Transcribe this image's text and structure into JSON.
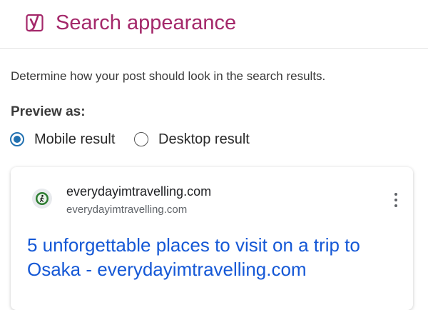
{
  "header": {
    "title": "Search appearance",
    "logo_icon": "yoast-logo-icon",
    "brand_color": "#a4286a"
  },
  "description": "Determine how your post should look in the search results.",
  "preview": {
    "label": "Preview as:",
    "options": [
      {
        "label": "Mobile result",
        "checked": true
      },
      {
        "label": "Desktop result",
        "checked": false
      }
    ],
    "accent_color": "#2271b1"
  },
  "snippet": {
    "favicon_icon": "hiker-favicon-icon",
    "site_name": "everydayimtravelling.com",
    "site_url": "everydayimtravelling.com",
    "menu_icon": "more-vertical-icon",
    "title": "5 unforgettable places to visit on a trip to Osaka - everydayimtravelling.com",
    "title_color": "#1558d6"
  }
}
